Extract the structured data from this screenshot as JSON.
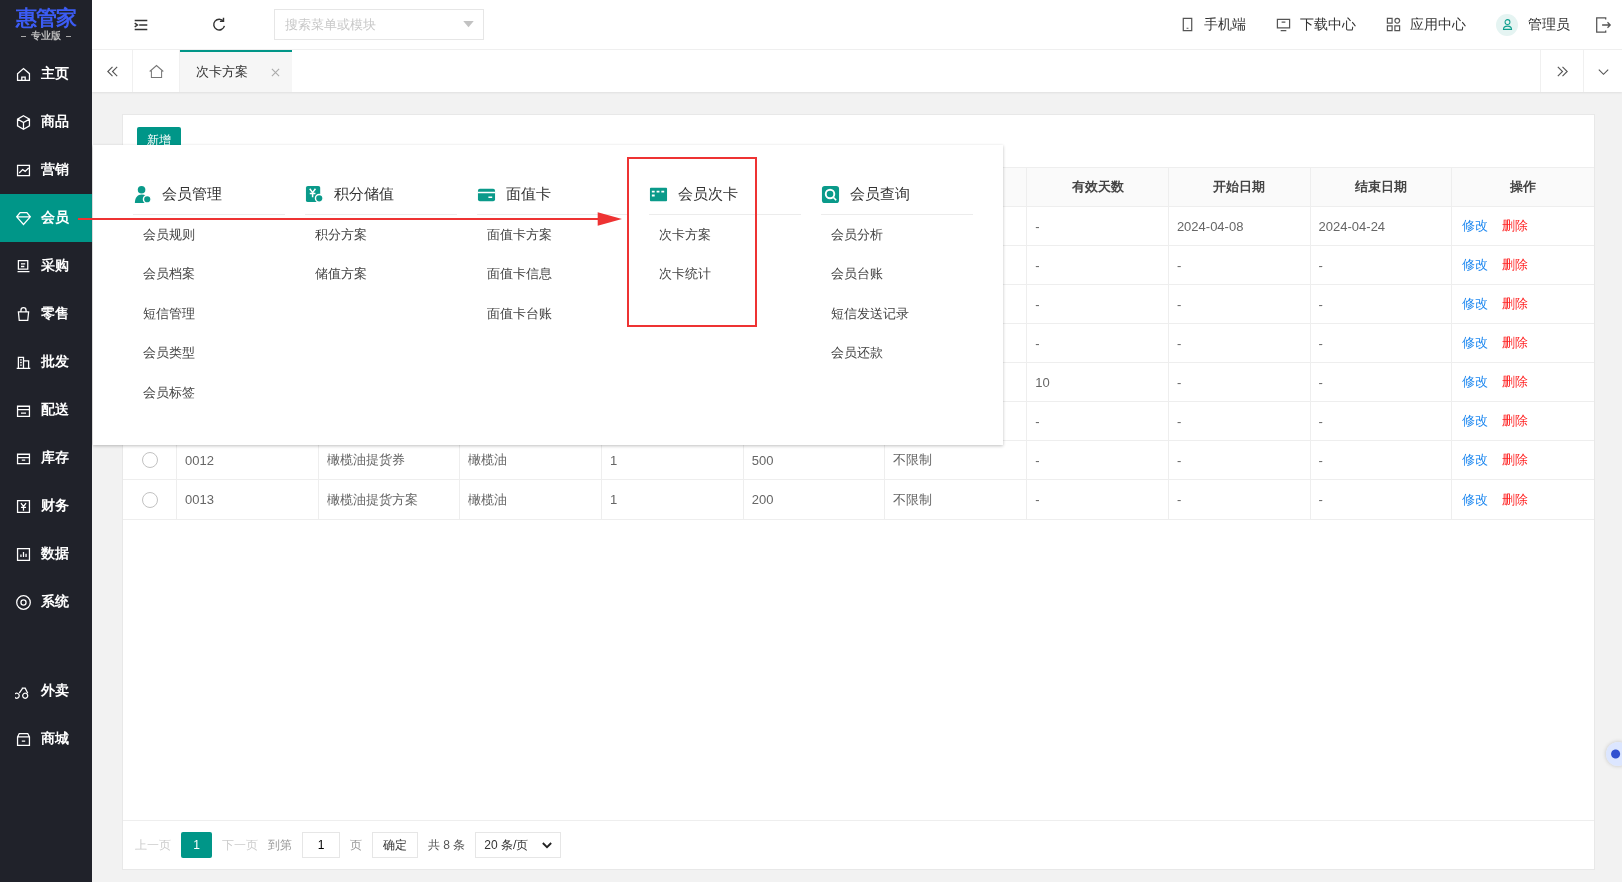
{
  "logo": {
    "name": "惠管家",
    "edition": "专业版"
  },
  "sidebar": {
    "items": [
      {
        "label": "主页",
        "selected": false
      },
      {
        "label": "商品",
        "selected": false
      },
      {
        "label": "营销",
        "selected": false
      },
      {
        "label": "会员",
        "selected": true
      },
      {
        "label": "采购",
        "selected": false
      },
      {
        "label": "零售",
        "selected": false
      },
      {
        "label": "批发",
        "selected": false
      },
      {
        "label": "配送",
        "selected": false
      },
      {
        "label": "库存",
        "selected": false
      },
      {
        "label": "财务",
        "selected": false
      },
      {
        "label": "数据",
        "selected": false
      },
      {
        "label": "系统",
        "selected": false
      }
    ],
    "bottom_items": [
      {
        "label": "外卖",
        "selected": false
      },
      {
        "label": "商城",
        "selected": false
      }
    ]
  },
  "search": {
    "placeholder": "搜索菜单或模块"
  },
  "header_links": [
    {
      "label": "手机端"
    },
    {
      "label": "下载中心"
    },
    {
      "label": "应用中心"
    }
  ],
  "user": {
    "name": "管理员"
  },
  "tabs": [
    {
      "label": "次卡方案",
      "selected": true
    }
  ],
  "add_button": "新增",
  "table": {
    "columns": [
      "有效天数",
      "开始日期",
      "结束日期",
      "操作"
    ],
    "rows": [
      {
        "days": "-",
        "start": "2024-04-08",
        "end": "2024-04-24",
        "actions": [
          "修改",
          "删除"
        ]
      },
      {
        "days": "-",
        "start": "-",
        "end": "-",
        "actions": [
          "修改",
          "删除"
        ]
      },
      {
        "days": "-",
        "start": "-",
        "end": "-",
        "actions": [
          "修改",
          "删除"
        ]
      },
      {
        "days": "-",
        "start": "-",
        "end": "-",
        "actions": [
          "修改",
          "删除"
        ]
      },
      {
        "days": "10",
        "start": "-",
        "end": "-",
        "actions": [
          "修改",
          "删除"
        ]
      },
      {
        "days": "-",
        "start": "-",
        "end": "-",
        "actions": [
          "修改",
          "删除"
        ]
      },
      {
        "selected": false,
        "lead": [
          "0012",
          "橄榄油提货券",
          "橄榄油",
          "1",
          "500",
          "不限制"
        ],
        "days": "-",
        "start": "-",
        "end": "-",
        "actions": [
          "修改",
          "删除"
        ]
      },
      {
        "selected": false,
        "lead": [
          "0013",
          "橄榄油提货方案",
          "橄榄油",
          "1",
          "200",
          "不限制"
        ],
        "days": "-",
        "start": "-",
        "end": "-",
        "actions": [
          "修改",
          "删除"
        ]
      }
    ]
  },
  "pagination": {
    "prev": {
      "label": "上一页",
      "disabled": true
    },
    "pages": [
      {
        "label": "1",
        "selected": true
      }
    ],
    "next": {
      "label": "下一页",
      "disabled": true
    },
    "goto_label": "到第",
    "page_input": "1",
    "page_unit": "页",
    "confirm": "确定",
    "total": "共 8 条",
    "page_size": "20 条/页"
  },
  "menu_panel": {
    "groups": [
      {
        "title": "会员管理",
        "items": [
          "会员规则",
          "会员档案",
          "短信管理",
          "会员类型",
          "会员标签"
        ]
      },
      {
        "title": "积分储值",
        "items": [
          "积分方案",
          "储值方案"
        ]
      },
      {
        "title": "面值卡",
        "items": [
          "面值卡方案",
          "面值卡信息",
          "面值卡台账"
        ]
      },
      {
        "title": "会员次卡",
        "items": [
          "次卡方案",
          "次卡统计"
        ],
        "highlighted": true
      },
      {
        "title": "会员查询",
        "items": [
          "会员分析",
          "会员台账",
          "短信发送记录",
          "会员还款"
        ]
      }
    ]
  }
}
